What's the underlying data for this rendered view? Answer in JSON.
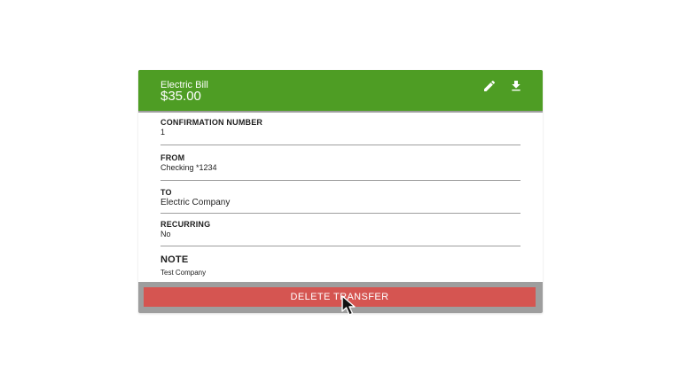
{
  "header": {
    "payee": "Electric Bill",
    "amount": "$35.00",
    "edit_icon": "pencil-icon",
    "download_icon": "download-icon",
    "color": "#4e9d24"
  },
  "details": {
    "confirmation": {
      "label": "CONFIRMATION NUMBER",
      "value": "1"
    },
    "from": {
      "label": "FROM",
      "value": "Checking *1234"
    },
    "to": {
      "label": "TO",
      "value": "Electric Company"
    },
    "recurring": {
      "label": "RECURRING",
      "value": "No"
    },
    "note": {
      "label": "NOTE",
      "value": "Test Company"
    }
  },
  "actions": {
    "delete_label": "DELETE TRANSFER",
    "delete_color": "#d55551"
  }
}
